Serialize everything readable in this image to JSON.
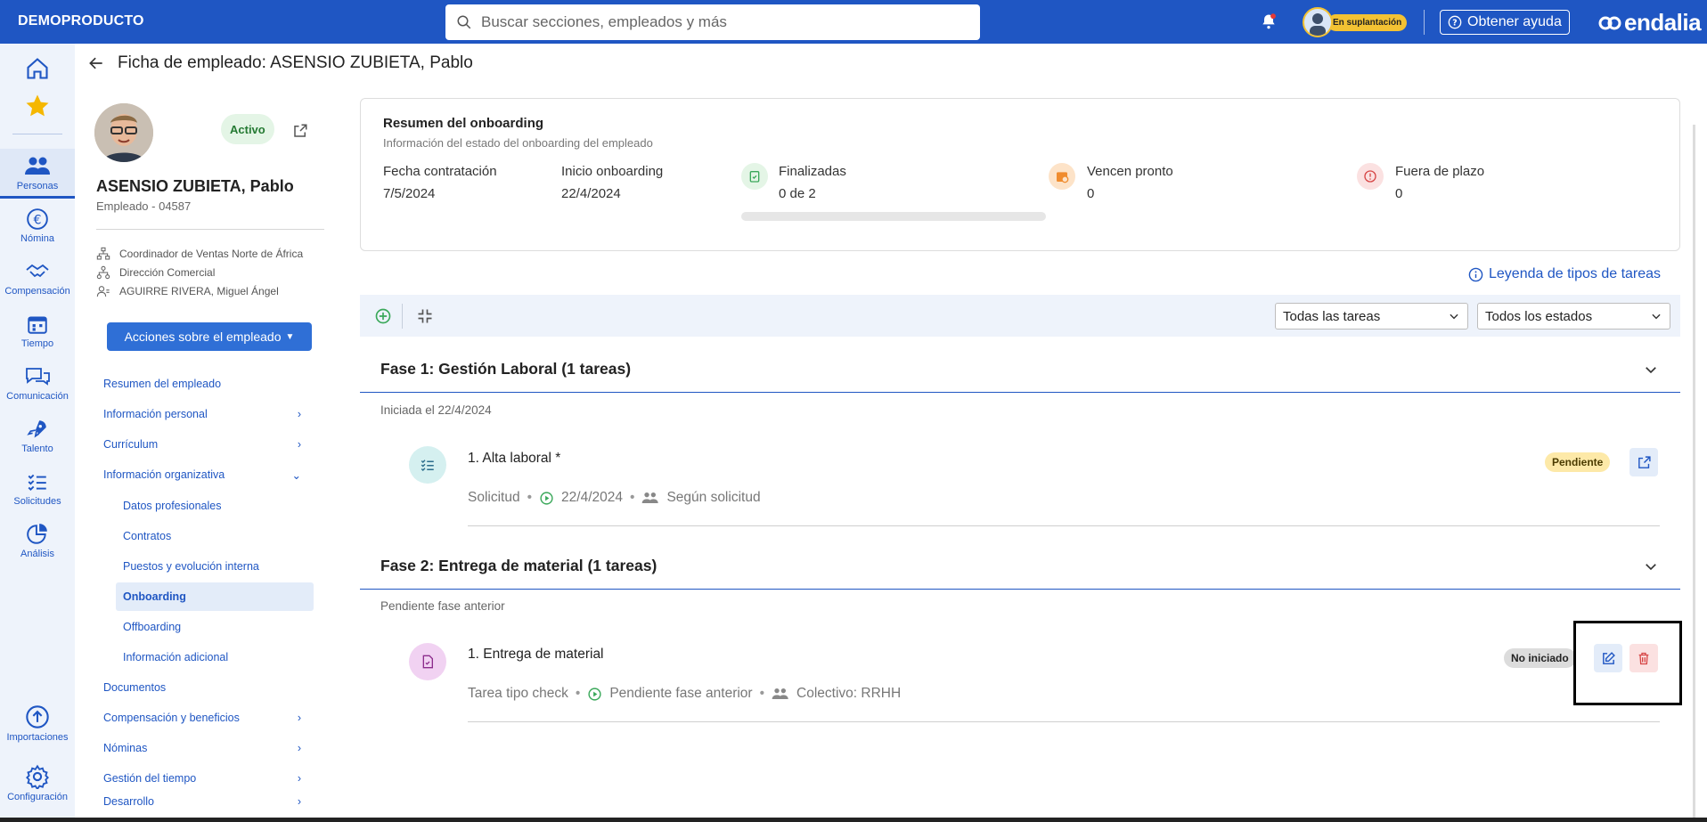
{
  "topbar": {
    "brand": "DEMOPRODUCTO",
    "search_placeholder": "Buscar secciones, empleados y más",
    "impersonation_badge": "En suplantación",
    "help_label": "Obtener ayuda",
    "logo_text": "endalia"
  },
  "rail": {
    "items": [
      {
        "label": "Personas"
      },
      {
        "label": "Nómina"
      },
      {
        "label": "Compensación"
      },
      {
        "label": "Tiempo"
      },
      {
        "label": "Comunicación"
      },
      {
        "label": "Talento"
      },
      {
        "label": "Solicitudes"
      },
      {
        "label": "Análisis"
      },
      {
        "label": "Importaciones"
      },
      {
        "label": "Configuración"
      }
    ]
  },
  "header": {
    "title": "Ficha de empleado: ASENSIO ZUBIETA, Pablo"
  },
  "profile": {
    "status": "Activo",
    "name": "ASENSIO ZUBIETA, Pablo",
    "employee_id": "Empleado - 04587",
    "position": "Coordinador de Ventas Norte de África",
    "department": "Dirección Comercial",
    "manager": "AGUIRRE RIVERA, Miguel Ángel",
    "actions_label": "Acciones sobre el empleado"
  },
  "menu": {
    "items": [
      {
        "label": "Resumen del empleado"
      },
      {
        "label": "Información personal"
      },
      {
        "label": "Currículum"
      },
      {
        "label": "Información organizativa"
      },
      {
        "label": "Datos profesionales"
      },
      {
        "label": "Contratos"
      },
      {
        "label": "Puestos y evolución interna"
      },
      {
        "label": "Onboarding"
      },
      {
        "label": "Offboarding"
      },
      {
        "label": "Información adicional"
      },
      {
        "label": "Documentos"
      },
      {
        "label": "Compensación y beneficios"
      },
      {
        "label": "Nóminas"
      },
      {
        "label": "Gestión del tiempo"
      },
      {
        "label": "Desarrollo"
      }
    ]
  },
  "summary": {
    "title": "Resumen del onboarding",
    "subtitle": "Información del estado del onboarding del empleado",
    "hire_date_label": "Fecha contratación",
    "hire_date": "7/5/2024",
    "start_label": "Inicio onboarding",
    "start_date": "22/4/2024",
    "completed_label": "Finalizadas",
    "completed_value": "0 de 2",
    "completed_fraction": 0,
    "due_soon_label": "Vencen pronto",
    "due_soon_value": "0",
    "overdue_label": "Fuera de plazo",
    "overdue_value": "0"
  },
  "legend_link": "Leyenda de tipos de tareas",
  "filters": {
    "tasks": "Todas las tareas",
    "states": "Todos los estados"
  },
  "phases": [
    {
      "title": "Fase 1: Gestión Laboral (1 tareas)",
      "subtitle": "Iniciada el 22/4/2024",
      "task": {
        "title": "1. Alta laboral *",
        "type": "Solicitud",
        "date": "22/4/2024",
        "assignee": "Según solicitud",
        "status": "Pendiente"
      }
    },
    {
      "title": "Fase 2: Entrega de material (1 tareas)",
      "subtitle": "Pendiente fase anterior",
      "task": {
        "title": "1. Entrega de material",
        "type": "Tarea tipo check",
        "date": "Pendiente fase anterior",
        "assignee": "Colectivo: RRHH",
        "status": "No iniciado"
      }
    }
  ],
  "colors": {
    "primary": "#1f56c3",
    "rail_bg": "#eef3fb",
    "success": "#3aa85a",
    "warning": "#f3c233",
    "danger": "#d64545"
  }
}
